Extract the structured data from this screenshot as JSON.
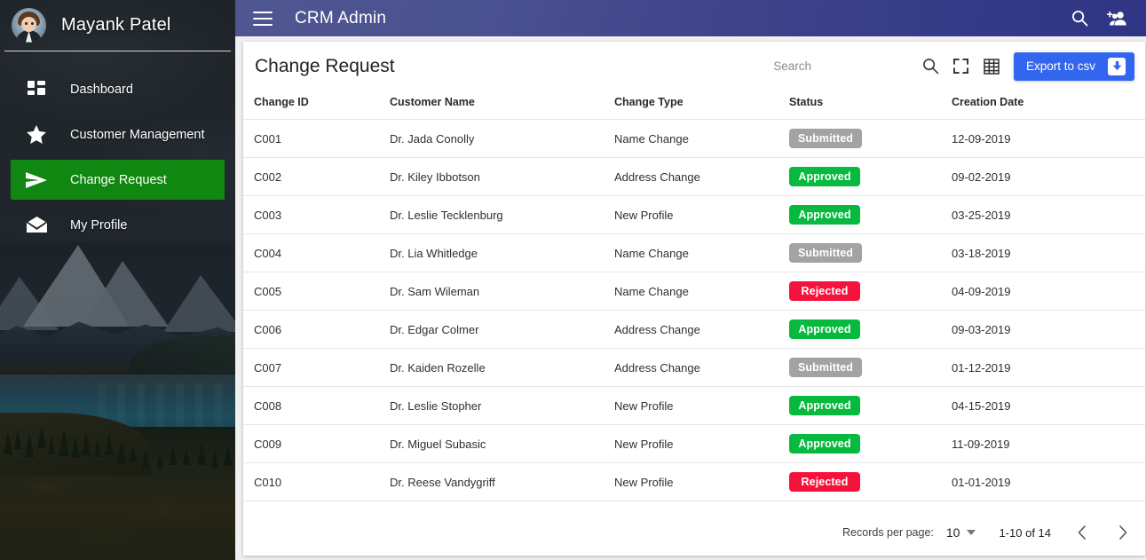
{
  "sidebar": {
    "user_name": "Mayank Patel",
    "avatar_icon": "user-avatar",
    "items": [
      {
        "label": "Dashboard",
        "icon": "dashboard-icon",
        "active": false
      },
      {
        "label": "Customer Management",
        "icon": "star-icon",
        "active": false
      },
      {
        "label": "Change Request",
        "icon": "send-icon",
        "active": true
      },
      {
        "label": "My Profile",
        "icon": "envelope-icon",
        "active": false
      }
    ],
    "active_color": "#108710"
  },
  "topbar": {
    "menu_icon": "hamburger-icon",
    "title": "CRM Admin",
    "search_icon": "search-icon",
    "add_user_icon": "add-user-icon",
    "background_from": "#4f5691",
    "background_to": "#2f3585"
  },
  "toolbar": {
    "page_title": "Change Request",
    "search_placeholder": "Search",
    "search_icon": "search-icon",
    "fullscreen_icon": "fullscreen-icon",
    "grid_icon": "grid-icon",
    "export_label": "Export to csv",
    "export_icon": "download-icon",
    "export_color": "#3366ee"
  },
  "table": {
    "columns": [
      "Change ID",
      "Customer Name",
      "Change Type",
      "Status",
      "Creation Date"
    ],
    "rows": [
      {
        "id": "C001",
        "name": "Dr. Jada Conolly",
        "type": "Name Change",
        "status": "Submitted",
        "date": "12-09-2019"
      },
      {
        "id": "C002",
        "name": "Dr. Kiley Ibbotson",
        "type": "Address Change",
        "status": "Approved",
        "date": "09-02-2019"
      },
      {
        "id": "C003",
        "name": "Dr. Leslie Tecklenburg",
        "type": "New Profile",
        "status": "Approved",
        "date": "03-25-2019"
      },
      {
        "id": "C004",
        "name": "Dr. Lia Whitledge",
        "type": "Name Change",
        "status": "Submitted",
        "date": "03-18-2019"
      },
      {
        "id": "C005",
        "name": "Dr. Sam Wileman",
        "type": "Name Change",
        "status": "Rejected",
        "date": "04-09-2019"
      },
      {
        "id": "C006",
        "name": "Dr. Edgar Colmer",
        "type": "Address Change",
        "status": "Approved",
        "date": "09-03-2019"
      },
      {
        "id": "C007",
        "name": "Dr. Kaiden Rozelle",
        "type": "Address Change",
        "status": "Submitted",
        "date": "01-12-2019"
      },
      {
        "id": "C008",
        "name": "Dr. Leslie Stopher",
        "type": "New Profile",
        "status": "Approved",
        "date": "04-15-2019"
      },
      {
        "id": "C009",
        "name": "Dr. Miguel Subasic",
        "type": "New Profile",
        "status": "Approved",
        "date": "11-09-2019"
      },
      {
        "id": "C010",
        "name": "Dr. Reese Vandygriff",
        "type": "New Profile",
        "status": "Rejected",
        "date": "01-01-2019"
      }
    ],
    "status_colors": {
      "Submitted": "#a3a3a3",
      "Approved": "#07b93f",
      "Rejected": "#f5123c"
    }
  },
  "pagination": {
    "records_label": "Records per page:",
    "records_value": "10",
    "range": "1-10 of 14",
    "prev_icon": "chevron-left-icon",
    "next_icon": "chevron-right-icon"
  }
}
